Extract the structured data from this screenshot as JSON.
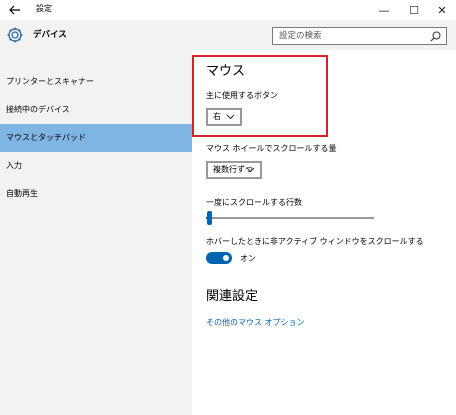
{
  "window": {
    "title": "設定",
    "back_icon": "back-arrow-icon",
    "minimize_glyph": "—",
    "maximize_glyph": "☐",
    "close_glyph": "✕"
  },
  "header": {
    "heading": "デバイス",
    "icon": "gear-icon"
  },
  "search": {
    "placeholder": "設定の検索",
    "icon": "search-icon"
  },
  "sidebar": {
    "items": [
      {
        "label": "プリンターとスキャナー",
        "selected": false
      },
      {
        "label": "接続中のデバイス",
        "selected": false
      },
      {
        "label": "マウスとタッチパッド",
        "selected": true
      },
      {
        "label": "入力",
        "selected": false
      },
      {
        "label": "自動再生",
        "selected": false
      }
    ]
  },
  "main": {
    "mouse_heading": "マウス",
    "primary_button_label": "主に使用するボタン",
    "primary_button_value": "右",
    "scroll_wheel_label": "マウス ホイールでスクロールする量",
    "scroll_wheel_value": "複数行ずつ",
    "lines_label": "一度にスクロールする行数",
    "lines_level_fraction": 0.02,
    "inactive_scroll_label": "ホバーしたときに非アクティブ ウィンドウをスクロールする",
    "inactive_scroll_state": "オン",
    "related_heading": "関連設定",
    "other_mouse_options_link": "その他のマウス オプション"
  },
  "colors": {
    "accent": "#0063b1",
    "selection": "#7fb5e3",
    "highlight_border": "#d7232a",
    "sidebar_bg": "#f2f2f2"
  }
}
